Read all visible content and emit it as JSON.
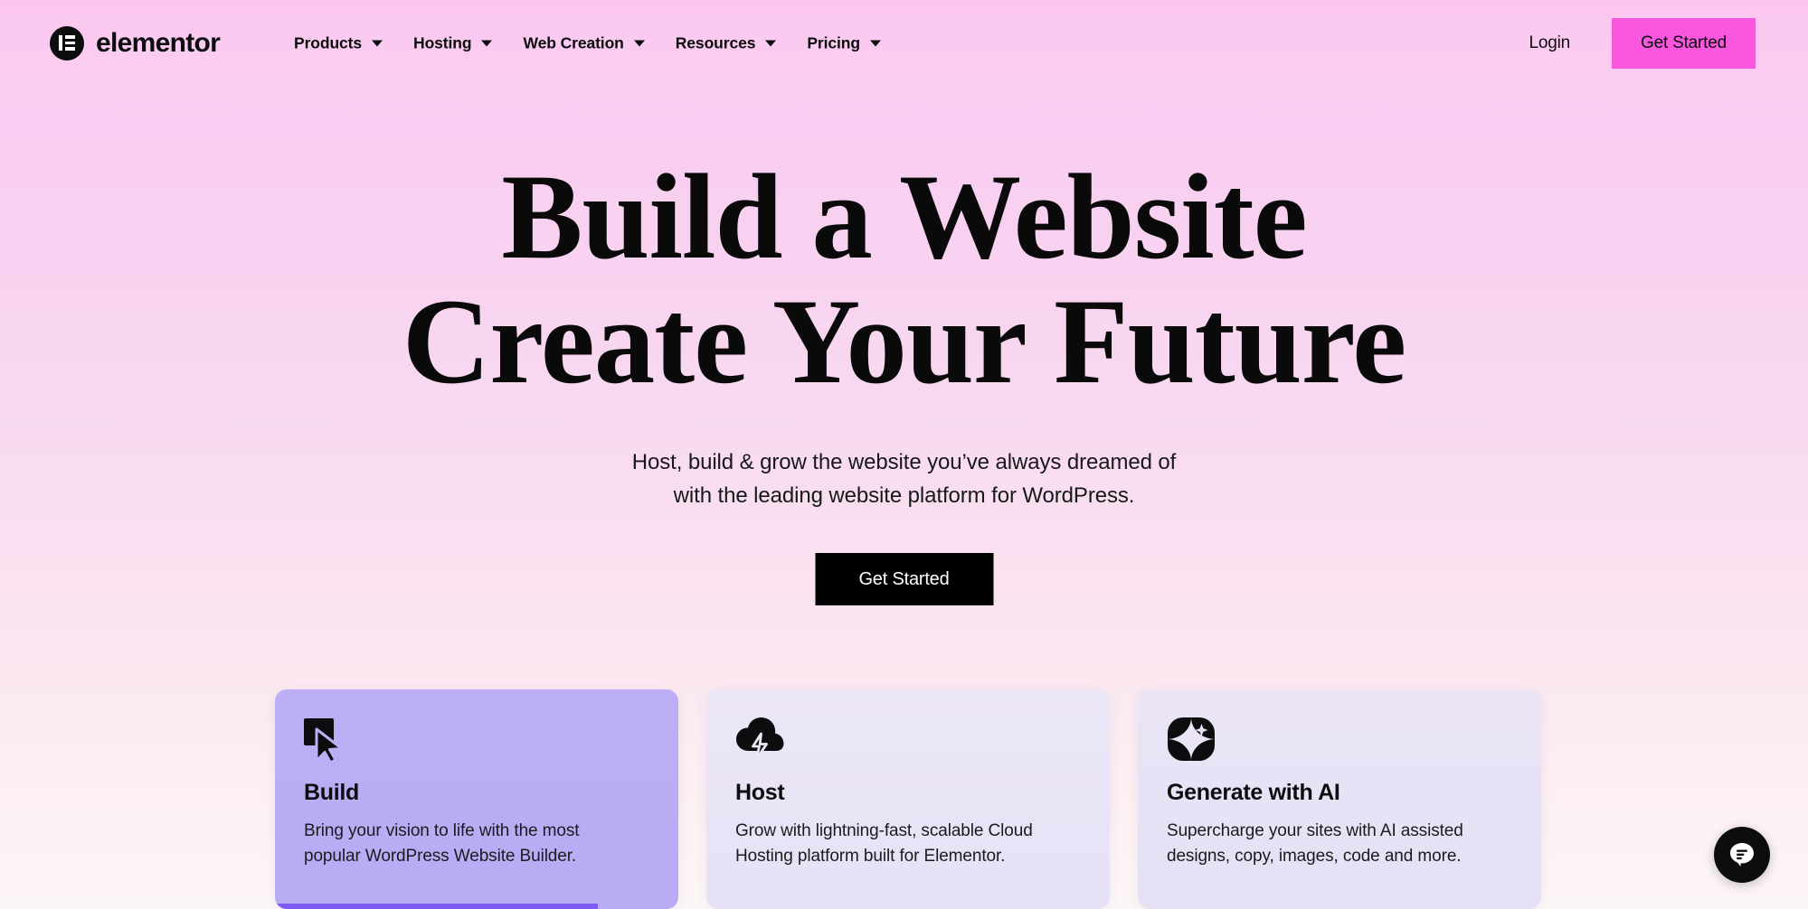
{
  "header": {
    "logo_text": "elementor",
    "logo_icon": "elementor-logo-icon",
    "nav": [
      {
        "label": "Products",
        "icon": "chevron-down-icon"
      },
      {
        "label": "Hosting",
        "icon": "chevron-down-icon"
      },
      {
        "label": "Web Creation",
        "icon": "chevron-down-icon"
      },
      {
        "label": "Resources",
        "icon": "chevron-down-icon"
      },
      {
        "label": "Pricing",
        "icon": "chevron-down-icon"
      }
    ],
    "login_label": "Login",
    "get_started_label": "Get Started",
    "get_started_color": "#F957DD"
  },
  "hero": {
    "title_line1": "Build a Website",
    "title_line2": "Create Your Future",
    "subtitle_line1": "Host, build & grow the website you’ve always dreamed of",
    "subtitle_line2": "with the leading website platform for WordPress.",
    "cta_label": "Get Started",
    "cta_color": "#000000"
  },
  "cards": [
    {
      "icon": "cursor-pointer-icon",
      "title": "Build",
      "desc_line1": "Bring your vision to life with the most",
      "desc_line2": "popular WordPress Website Builder.",
      "bg_color": "#BDAFF5",
      "progress_percent": 80,
      "progress_color": "#7C5CF0",
      "active": true
    },
    {
      "icon": "cloud-lightning-icon",
      "title": "Host",
      "desc_line1": "Grow with lightning-fast, scalable Cloud",
      "desc_line2": "Hosting platform built for Elementor.",
      "bg_color": "#ECE7F7",
      "progress_percent": 0,
      "progress_color": "#7C5CF0",
      "active": false
    },
    {
      "icon": "ai-sparkle-icon",
      "title": "Generate with AI",
      "desc_line1": "Supercharge your sites with AI assisted",
      "desc_line2": "designs, copy, images, code and more.",
      "bg_color": "#EAE4F6",
      "progress_percent": 0,
      "progress_color": "#7C5CF0",
      "active": false
    }
  ],
  "chat": {
    "icon": "chat-bubble-icon"
  },
  "theme": {
    "bg_gradient_top": "#FBC6EE",
    "bg_gradient_bottom": "#FDF6F6",
    "text_color": "#0C0D0E"
  }
}
